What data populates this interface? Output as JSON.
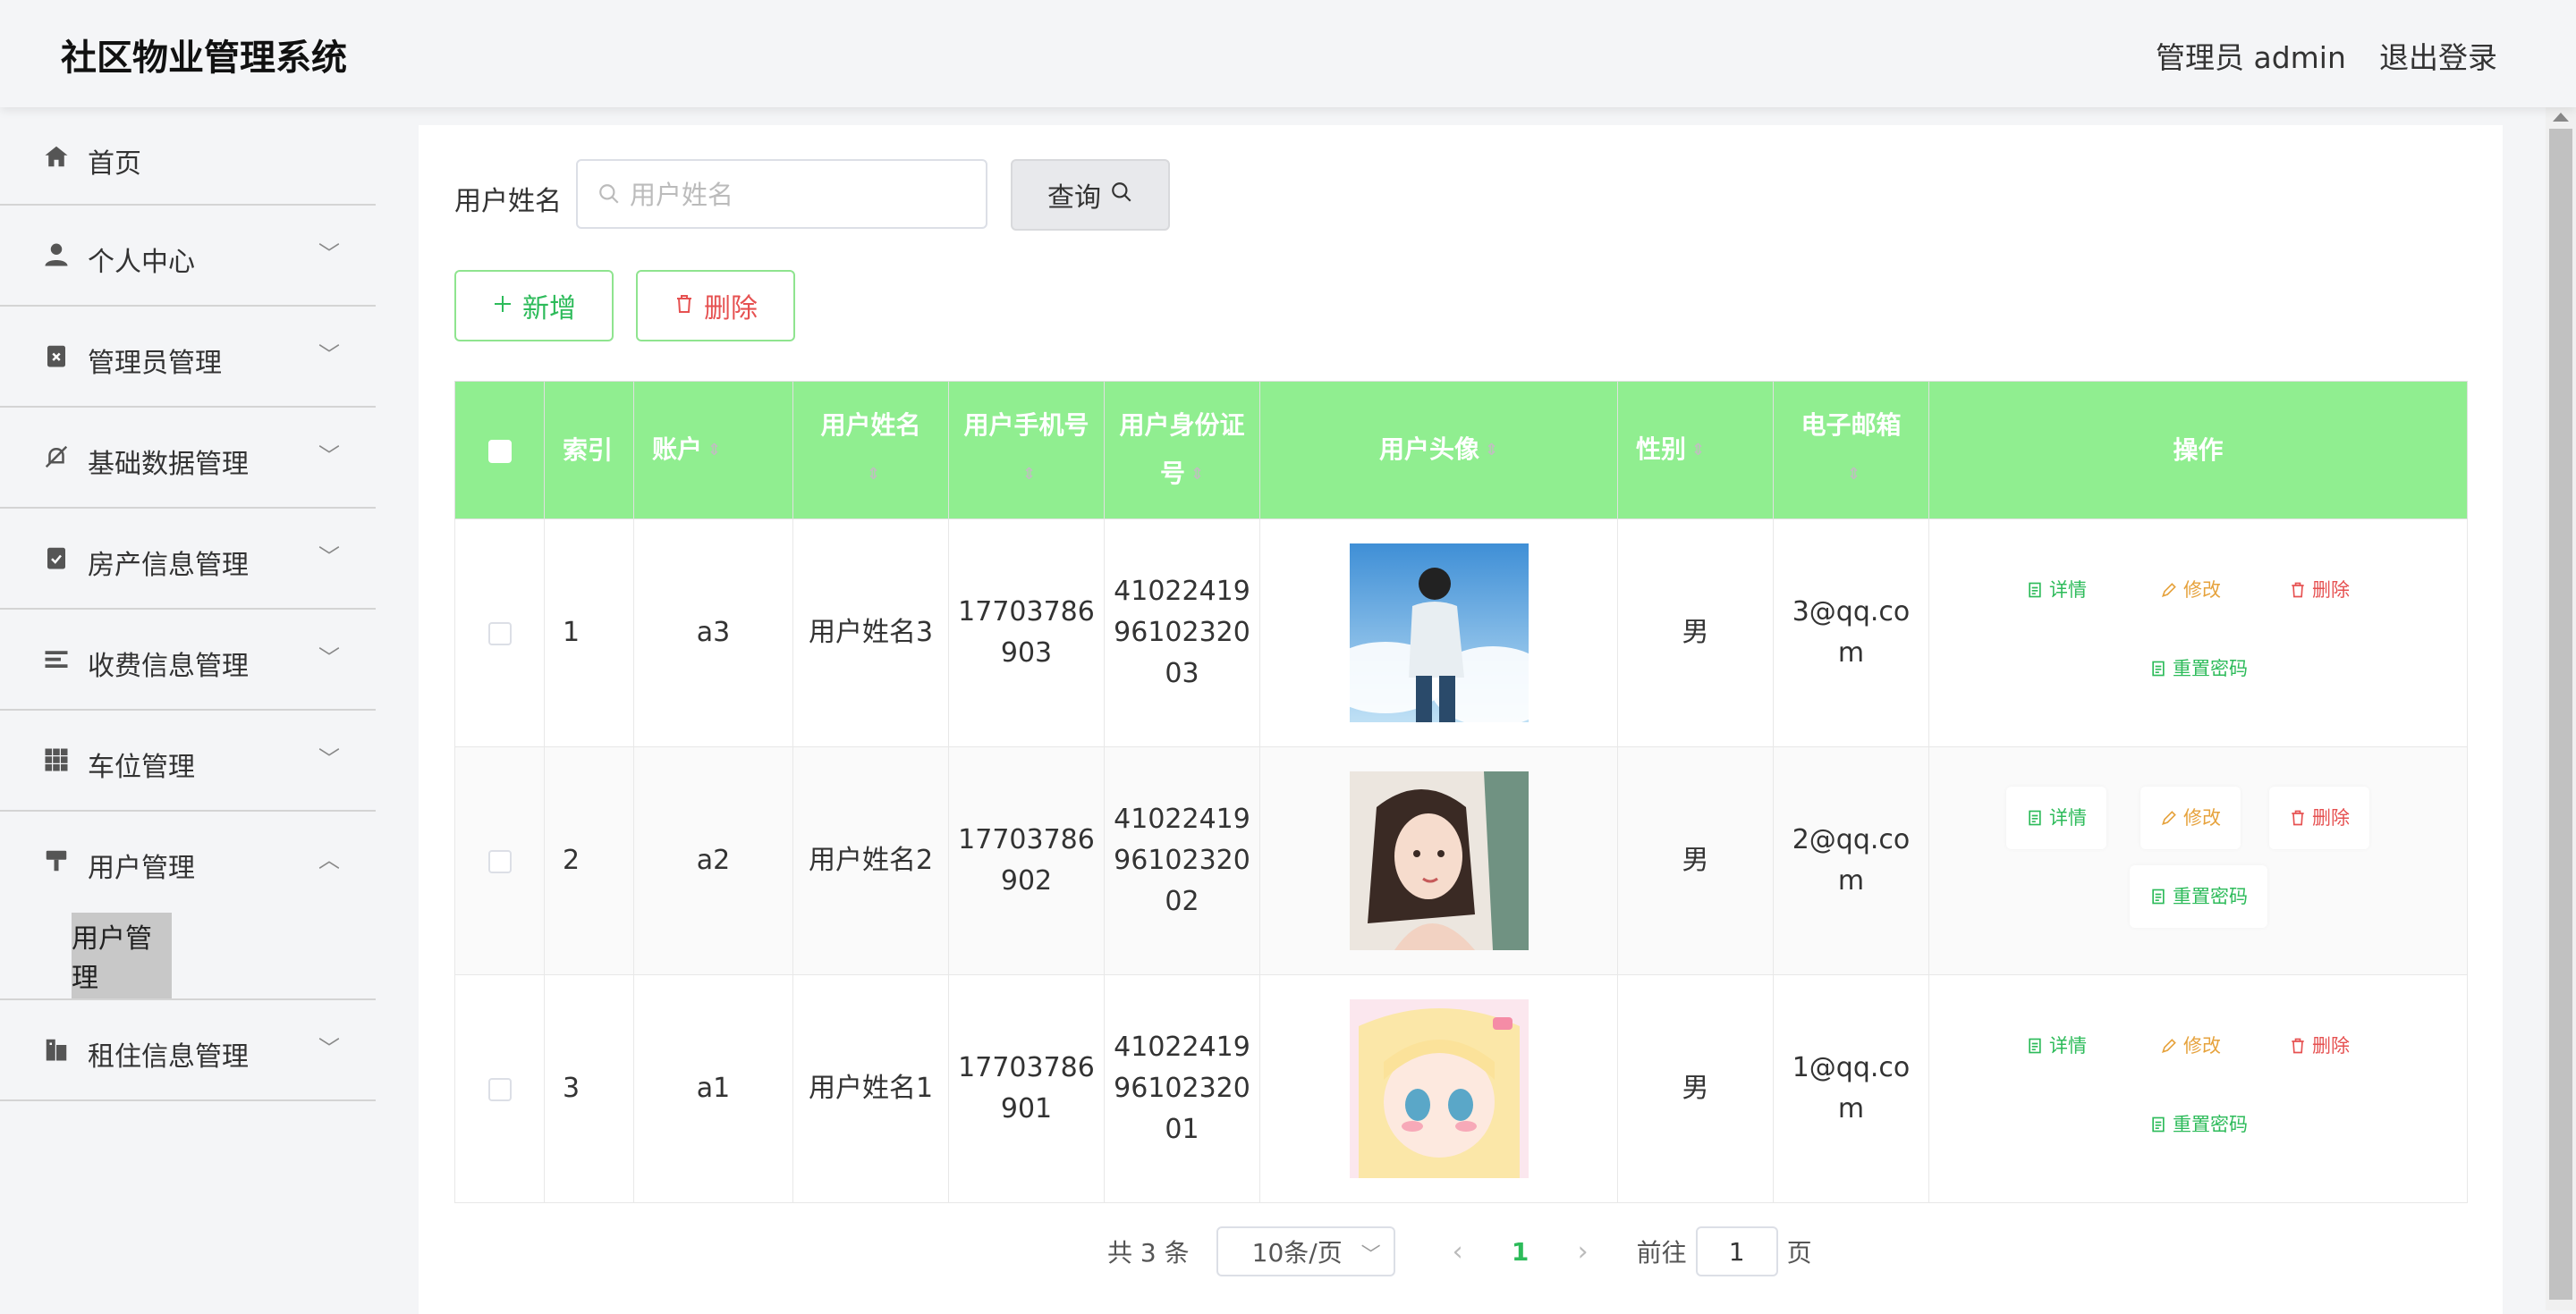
{
  "header": {
    "title": "社区物业管理系统",
    "user": "管理员 admin",
    "logout": "退出登录"
  },
  "sidebar": {
    "items": [
      {
        "label": "首页",
        "icon": "home-icon"
      },
      {
        "label": "个人中心",
        "icon": "user-icon",
        "arrow": "﹀"
      },
      {
        "label": "管理员管理",
        "icon": "clipboard-x-icon",
        "arrow": "﹀"
      },
      {
        "label": "基础数据管理",
        "icon": "bell-off-icon",
        "arrow": "﹀"
      },
      {
        "label": "房产信息管理",
        "icon": "clipboard-check-icon",
        "arrow": "﹀"
      },
      {
        "label": "收费信息管理",
        "icon": "list-icon",
        "arrow": "﹀"
      },
      {
        "label": "车位管理",
        "icon": "grid-icon",
        "arrow": "﹀"
      },
      {
        "label": "用户管理",
        "icon": "brush-icon",
        "arrow": "︿"
      },
      {
        "label": "租住信息管理",
        "icon": "building-icon",
        "arrow": "﹀"
      }
    ],
    "subitem": "用户管理"
  },
  "search": {
    "label": "用户姓名",
    "placeholder": "用户姓名",
    "button": "查询"
  },
  "actions": {
    "add": "新增",
    "delete": "删除"
  },
  "table": {
    "headers": {
      "index": "索引",
      "account": "账户",
      "name": "用户姓名",
      "phone": "用户手机号",
      "idcard": "用户身份证号",
      "avatar": "用户头像",
      "gender": "性别",
      "email": "电子邮箱",
      "ops": "操作"
    },
    "rows": [
      {
        "index": "1",
        "account": "a3",
        "name": "用户姓名3",
        "phone": "17703786903",
        "idcard": "410224199610232003",
        "gender": "男",
        "email": "3@qq.com"
      },
      {
        "index": "2",
        "account": "a2",
        "name": "用户姓名2",
        "phone": "17703786902",
        "idcard": "410224199610232002",
        "gender": "男",
        "email": "2@qq.com"
      },
      {
        "index": "3",
        "account": "a1",
        "name": "用户姓名1",
        "phone": "17703786901",
        "idcard": "410224199610232001",
        "gender": "男",
        "email": "1@qq.com"
      }
    ],
    "ops": {
      "detail": "详情",
      "edit": "修改",
      "remove": "删除",
      "reset": "重置密码"
    }
  },
  "pager": {
    "total": "共 3 条",
    "size": "10条/页",
    "current": "1",
    "goto": "前往",
    "goto_value": "1",
    "page_unit": "页"
  },
  "colors": {
    "header_bg": "#90ee90",
    "accent_green": "#2dbb5a",
    "danger": "#e65151",
    "warning": "#e6a23c"
  }
}
